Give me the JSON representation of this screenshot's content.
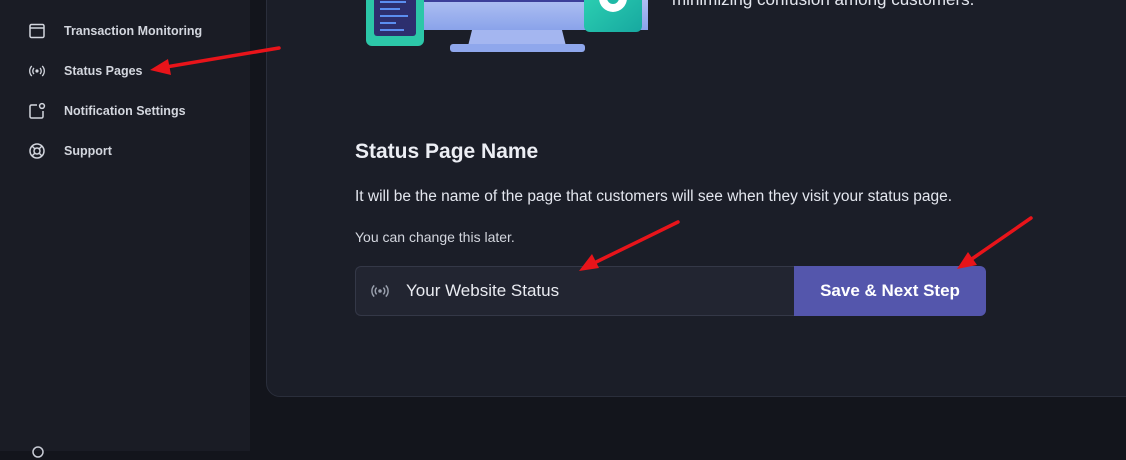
{
  "sidebar": {
    "items": [
      {
        "label": "Transaction Monitoring",
        "icon": "browser-window-icon"
      },
      {
        "label": "Status Pages",
        "icon": "broadcast-icon"
      },
      {
        "label": "Notification Settings",
        "icon": "notification-square-icon"
      },
      {
        "label": "Support",
        "icon": "lifebuoy-icon"
      }
    ]
  },
  "intro": {
    "text": "minimizing confusion among customers."
  },
  "status_page_name": {
    "title": "Status Page Name",
    "description": "It will be the name of the page that customers will see when they visit your status page.",
    "hint": "You can change this later.",
    "input_value": "Your Website Status",
    "button_label": "Save & Next Step"
  },
  "colors": {
    "background": "#13151c",
    "sidebar": "#1a1c25",
    "card": "#1b1e28",
    "accent_button": "#5456ac",
    "annotation_arrow": "#e8141a"
  }
}
